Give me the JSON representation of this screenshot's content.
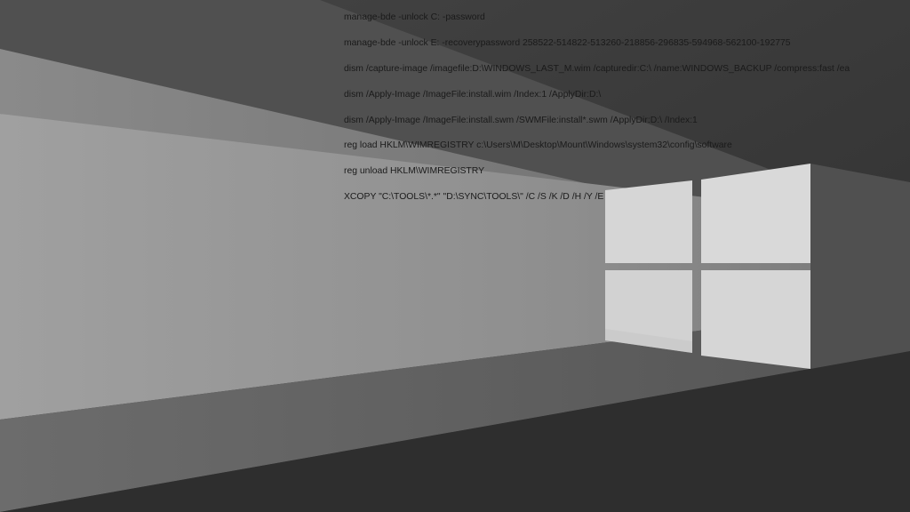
{
  "desktop": {
    "wallpaper": {
      "logo_icon": "windows-logo-icon",
      "colors": {
        "background": "#3a3a3a",
        "light_beam": "#9a9a9a",
        "logo_pane": "#d8d8d8"
      }
    },
    "notes": [
      "manage-bde -unlock C: -password",
      "manage-bde -unlock E: -recoverypassword 258522-514822-513260-218856-296835-594968-562100-192775",
      "dism /capture-image /imagefile:D:\\WINDOWS_LAST_M.wim /capturedir:C:\\ /name:WINDOWS_BACKUP /compress:fast /ea",
      "dism /Apply-Image /ImageFile:install.wim /Index:1 /ApplyDir:D:\\",
      "dism /Apply-Image /ImageFile:install.swm /SWMFile:install*.swm /ApplyDir:D:\\ /Index:1",
      "reg load HKLM\\WIMREGISTRY c:\\Users\\M\\Desktop\\Mount\\Windows\\system32\\config\\software",
      "reg unload HKLM\\WIMREGISTRY",
      "XCOPY \"C:\\TOOLS\\*.*\" \"D:\\SYNC\\TOOLS\\\" /C /S /K /D /H /Y /E"
    ]
  }
}
